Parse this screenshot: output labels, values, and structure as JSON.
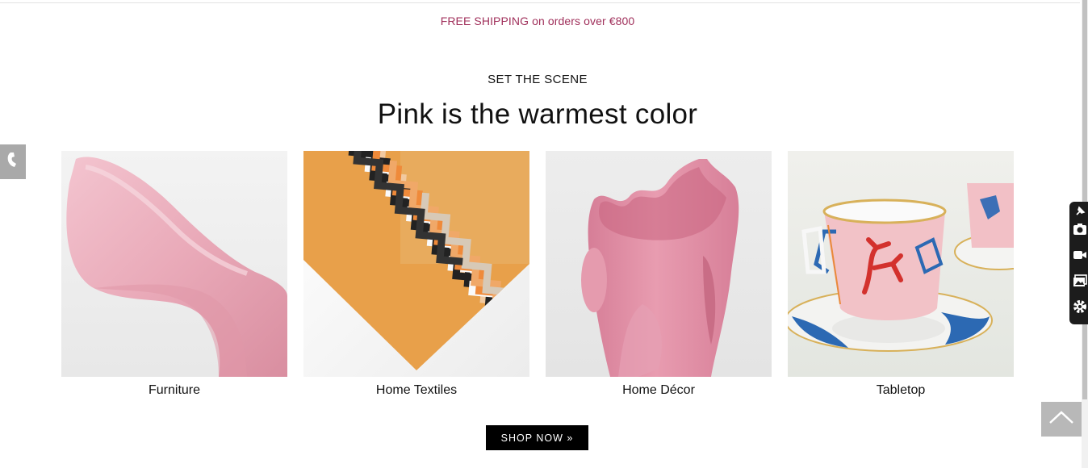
{
  "banner": {
    "shipping_text": "FREE SHIPPING on orders over €800"
  },
  "section": {
    "eyebrow": "SET THE SCENE",
    "headline": "Pink is the warmest color"
  },
  "categories": [
    {
      "label": "Furniture",
      "image": "pink-chair-photo"
    },
    {
      "label": "Home Textiles",
      "image": "zigzag-cushion-photo"
    },
    {
      "label": "Home Décor",
      "image": "pink-vase-photo"
    },
    {
      "label": "Tabletop",
      "image": "coral-cup-photo"
    }
  ],
  "cta": {
    "label": "SHOP NOW »"
  },
  "widgets": {
    "phone_icon": "phone-icon",
    "back_to_top_icon": "chevron-up-icon",
    "toolbar_icons": [
      "pin-icon",
      "camera-icon",
      "video-icon",
      "gallery-icon",
      "gear-icon"
    ]
  },
  "colors": {
    "accent": "#a0305b",
    "button_bg": "#000000",
    "pink": "#e7a5b8"
  }
}
